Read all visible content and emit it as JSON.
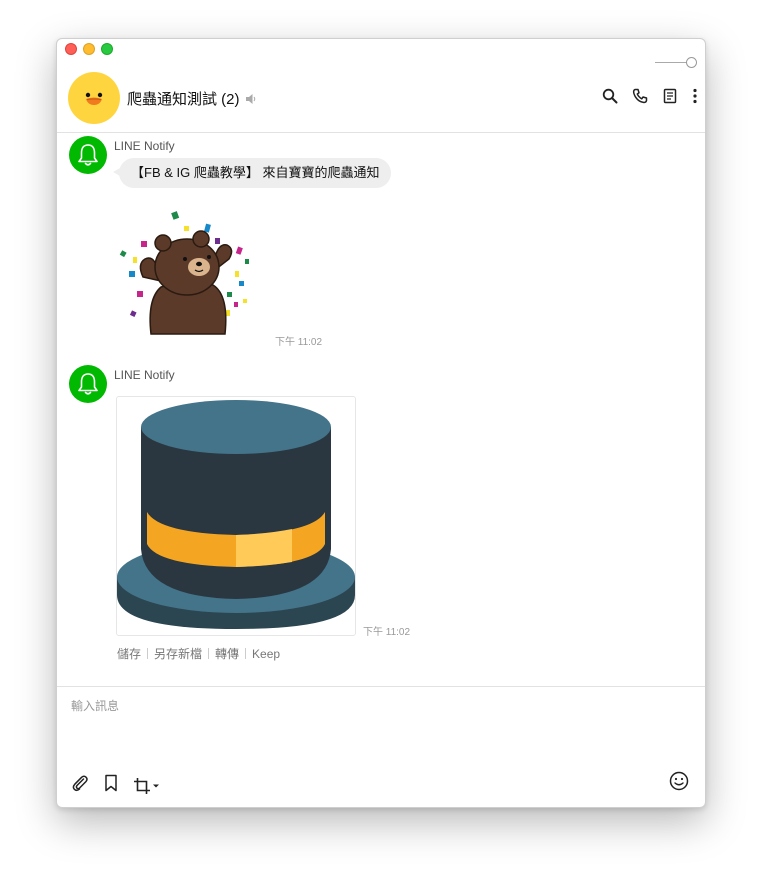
{
  "header": {
    "room_name": "爬蟲通知測試 (2)"
  },
  "messages": [
    {
      "sender": "LINE Notify",
      "text": "【FB & IG 爬蟲教學】 來自寶寶的爬蟲通知",
      "time": "下午 11:02"
    },
    {
      "sender": "LINE Notify",
      "time": "下午 11:02",
      "actions": [
        "儲存",
        "另存新檔",
        "轉傳",
        "Keep"
      ]
    }
  ],
  "input": {
    "placeholder": "輸入訊息"
  },
  "icons": {
    "header": [
      "search-icon",
      "phone-icon",
      "notes-icon",
      "more-icon"
    ],
    "toolbar": [
      "paperclip-icon",
      "bookmark-icon",
      "crop-icon"
    ],
    "emoji": "emoji-icon"
  },
  "colors": {
    "line_green": "#00b900",
    "avatar_yellow": "#ffd53f",
    "bubble_gray": "#eeeeee"
  }
}
